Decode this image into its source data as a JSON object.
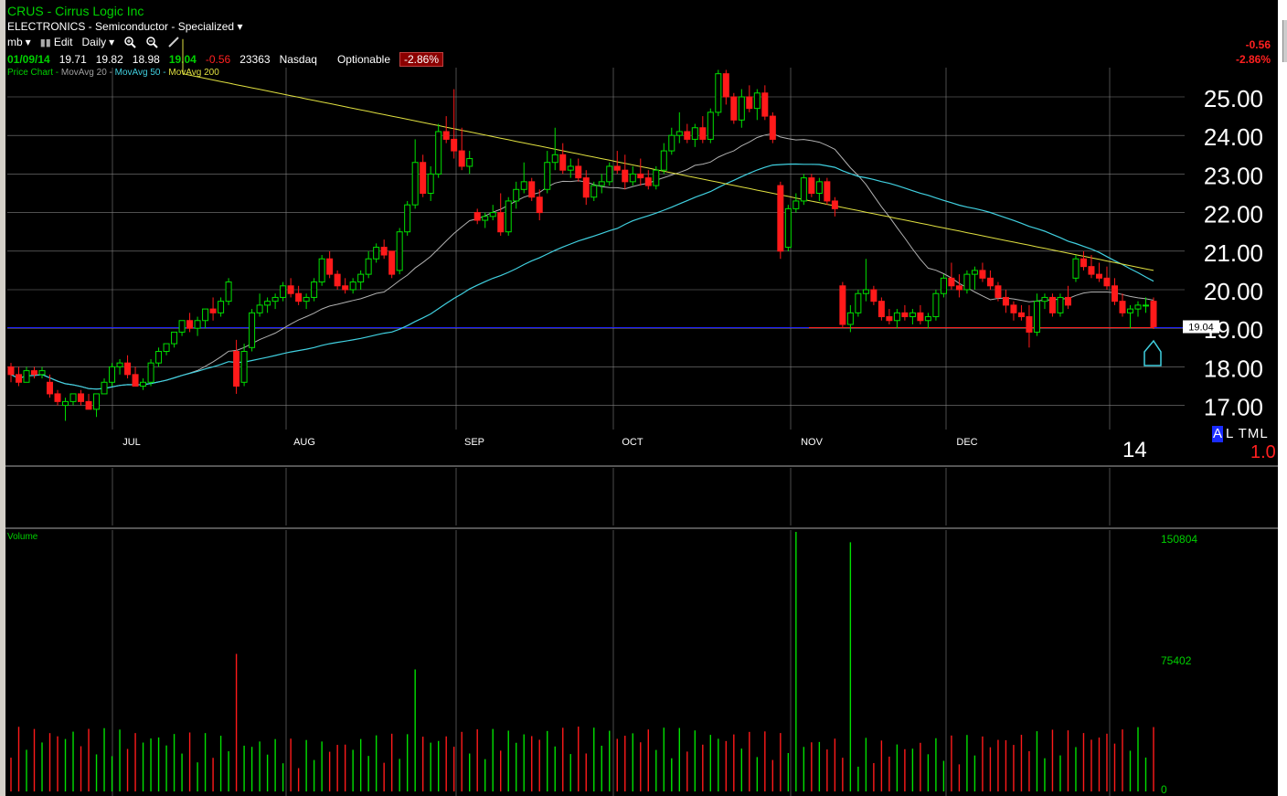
{
  "header": {
    "symbol": "CRUS",
    "company": "Cirrus Logic Inc",
    "sector": "ELECTRONICS - Semiconductor - Specialized",
    "toolbar": {
      "list": "mb",
      "edit": "Edit",
      "period": "Daily"
    },
    "quote": {
      "date": "01/09/14",
      "open": "19.71",
      "high": "19.82",
      "low": "18.98",
      "close": "19.04",
      "change": "-0.56",
      "volume": "23363",
      "exchange": "Nasdaq",
      "optionable": "Optionable",
      "pct": "-2.86%"
    },
    "legend": {
      "price": "Price Chart -",
      "ma20": "MovAvg 20 -",
      "ma50": "MovAvg 50 -",
      "ma200": "MovAvg 200"
    }
  },
  "topright": {
    "change": "-0.56",
    "pct": "-2.86%"
  },
  "badges": {
    "al": "A",
    "tml": "L TML",
    "version": "1.0",
    "year": "14"
  },
  "price_axis": {
    "current_label": "19.04"
  },
  "volume_axis": {
    "label": "Volume",
    "max": "150804",
    "mid": "75402",
    "min": "0"
  },
  "colors": {
    "up": "#00e000",
    "down": "#ff1a1a",
    "ma20": "#b0b0b0",
    "ma50": "#40d0e0",
    "ma200": "#e0e040",
    "grid": "#808080",
    "hline": "#2020ff"
  },
  "chart_data": {
    "type": "candlestick",
    "months": [
      "JUL",
      "AUG",
      "SEP",
      "OCT",
      "NOV",
      "DEC"
    ],
    "yticks": [
      "25.00",
      "24.00",
      "23.00",
      "22.00",
      "21.00",
      "20.00",
      "19.00",
      "18.00",
      "17.00"
    ],
    "ylim": [
      16.5,
      25.8
    ],
    "candles": [
      [
        18.0,
        18.1,
        17.6,
        17.8
      ],
      [
        17.8,
        18.0,
        17.5,
        17.6
      ],
      [
        17.6,
        18.0,
        17.6,
        17.9
      ],
      [
        17.9,
        18.0,
        17.7,
        17.8
      ],
      [
        17.8,
        18.0,
        17.7,
        17.9
      ],
      [
        17.6,
        17.8,
        17.2,
        17.3
      ],
      [
        17.3,
        17.4,
        17.0,
        17.1
      ],
      [
        17.0,
        17.2,
        16.6,
        17.1
      ],
      [
        17.1,
        17.3,
        17.0,
        17.3
      ],
      [
        17.3,
        17.4,
        17.0,
        17.1
      ],
      [
        17.1,
        17.3,
        16.9,
        16.9
      ],
      [
        16.9,
        17.3,
        16.7,
        17.3
      ],
      [
        17.3,
        17.7,
        17.3,
        17.6
      ],
      [
        17.6,
        18.1,
        17.5,
        18.0
      ],
      [
        18.0,
        18.2,
        17.8,
        18.1
      ],
      [
        18.1,
        18.3,
        17.7,
        17.8
      ],
      [
        17.8,
        18.0,
        17.5,
        17.5
      ],
      [
        17.5,
        17.7,
        17.4,
        17.6
      ],
      [
        17.6,
        18.2,
        17.5,
        18.1
      ],
      [
        18.1,
        18.5,
        18.0,
        18.4
      ],
      [
        18.4,
        18.6,
        18.3,
        18.6
      ],
      [
        18.6,
        18.9,
        18.5,
        18.9
      ],
      [
        18.9,
        19.2,
        18.8,
        19.2
      ],
      [
        19.2,
        19.4,
        18.9,
        19.0
      ],
      [
        19.0,
        19.3,
        18.8,
        19.2
      ],
      [
        19.2,
        19.5,
        19.0,
        19.5
      ],
      [
        19.5,
        19.8,
        19.2,
        19.4
      ],
      [
        19.4,
        19.8,
        19.3,
        19.7
      ],
      [
        19.7,
        20.3,
        19.6,
        20.2
      ],
      [
        18.4,
        18.7,
        17.3,
        17.5
      ],
      [
        17.6,
        18.6,
        17.5,
        18.4
      ],
      [
        18.5,
        19.5,
        18.4,
        19.4
      ],
      [
        19.4,
        19.9,
        19.3,
        19.6
      ],
      [
        19.6,
        19.8,
        19.4,
        19.7
      ],
      [
        19.7,
        19.9,
        19.5,
        19.8
      ],
      [
        19.8,
        20.2,
        19.7,
        20.1
      ],
      [
        20.1,
        20.3,
        19.8,
        19.9
      ],
      [
        19.9,
        20.1,
        19.6,
        19.7
      ],
      [
        19.7,
        19.9,
        19.5,
        19.8
      ],
      [
        19.8,
        20.3,
        19.7,
        20.2
      ],
      [
        20.2,
        20.9,
        20.1,
        20.8
      ],
      [
        20.8,
        21.0,
        20.3,
        20.4
      ],
      [
        20.4,
        20.5,
        20.0,
        20.1
      ],
      [
        20.1,
        20.3,
        19.9,
        20.0
      ],
      [
        20.0,
        20.3,
        19.9,
        20.2
      ],
      [
        20.2,
        20.5,
        20.0,
        20.4
      ],
      [
        20.4,
        21.0,
        20.3,
        20.8
      ],
      [
        20.8,
        21.2,
        20.7,
        21.1
      ],
      [
        21.1,
        21.3,
        20.8,
        20.9
      ],
      [
        21.0,
        21.0,
        20.3,
        20.4
      ],
      [
        20.5,
        21.6,
        20.4,
        21.5
      ],
      [
        21.5,
        22.3,
        21.4,
        22.2
      ],
      [
        22.2,
        23.9,
        22.1,
        23.3
      ],
      [
        23.3,
        23.5,
        22.4,
        22.5
      ],
      [
        22.5,
        23.2,
        22.3,
        23.0
      ],
      [
        23.0,
        24.3,
        22.9,
        24.1
      ],
      [
        24.1,
        24.5,
        23.8,
        23.9
      ],
      [
        23.9,
        25.2,
        23.4,
        23.6
      ],
      [
        23.6,
        24.2,
        23.1,
        23.2
      ],
      [
        23.2,
        23.6,
        23.0,
        23.4
      ],
      [
        22.0,
        22.1,
        21.7,
        21.8
      ],
      [
        21.8,
        22.0,
        21.6,
        21.9
      ],
      [
        21.9,
        22.2,
        21.8,
        22.0
      ],
      [
        22.0,
        22.5,
        21.4,
        21.5
      ],
      [
        21.5,
        22.4,
        21.4,
        22.3
      ],
      [
        22.3,
        22.8,
        22.1,
        22.6
      ],
      [
        22.6,
        23.3,
        22.5,
        22.8
      ],
      [
        22.8,
        22.9,
        22.3,
        22.4
      ],
      [
        22.4,
        22.6,
        21.8,
        22.0
      ],
      [
        22.6,
        23.6,
        22.5,
        23.3
      ],
      [
        23.3,
        24.2,
        23.1,
        23.5
      ],
      [
        23.5,
        23.8,
        23.0,
        23.1
      ],
      [
        23.1,
        23.4,
        22.9,
        23.2
      ],
      [
        23.2,
        23.4,
        22.8,
        22.9
      ],
      [
        22.9,
        23.1,
        22.2,
        22.4
      ],
      [
        22.4,
        22.8,
        22.3,
        22.7
      ],
      [
        22.7,
        23.0,
        22.5,
        22.8
      ],
      [
        22.8,
        23.3,
        22.7,
        23.2
      ],
      [
        23.2,
        23.6,
        23.0,
        23.1
      ],
      [
        23.1,
        23.5,
        22.6,
        22.8
      ],
      [
        22.8,
        23.2,
        22.7,
        23.0
      ],
      [
        23.0,
        23.4,
        22.7,
        22.9
      ],
      [
        22.9,
        23.1,
        22.6,
        22.7
      ],
      [
        22.7,
        23.2,
        22.6,
        23.1
      ],
      [
        23.1,
        23.8,
        23.0,
        23.6
      ],
      [
        23.6,
        24.2,
        23.5,
        24.0
      ],
      [
        24.0,
        24.6,
        23.8,
        24.1
      ],
      [
        24.1,
        24.3,
        23.8,
        23.9
      ],
      [
        23.9,
        24.3,
        23.7,
        24.2
      ],
      [
        24.2,
        24.5,
        23.8,
        23.9
      ],
      [
        23.9,
        24.7,
        23.8,
        24.6
      ],
      [
        24.6,
        25.7,
        24.5,
        25.6
      ],
      [
        25.6,
        25.7,
        24.8,
        25.0
      ],
      [
        25.0,
        25.1,
        24.3,
        24.4
      ],
      [
        24.4,
        25.2,
        24.2,
        25.0
      ],
      [
        25.0,
        25.3,
        24.6,
        24.7
      ],
      [
        24.7,
        25.2,
        24.4,
        25.1
      ],
      [
        25.1,
        25.3,
        24.4,
        24.5
      ],
      [
        24.5,
        24.6,
        23.8,
        23.9
      ],
      [
        22.7,
        22.8,
        20.8,
        21.0
      ],
      [
        21.1,
        22.2,
        21.0,
        22.1
      ],
      [
        22.1,
        22.5,
        22.0,
        22.3
      ],
      [
        22.3,
        23.0,
        22.2,
        22.9
      ],
      [
        22.9,
        23.0,
        22.4,
        22.5
      ],
      [
        22.5,
        22.9,
        22.3,
        22.8
      ],
      [
        22.8,
        22.9,
        22.2,
        22.3
      ],
      [
        22.3,
        22.4,
        21.9,
        22.1
      ],
      [
        20.1,
        20.2,
        19.0,
        19.1
      ],
      [
        19.1,
        19.6,
        18.9,
        19.4
      ],
      [
        19.4,
        20.0,
        19.3,
        19.9
      ],
      [
        19.9,
        20.8,
        19.7,
        20.0
      ],
      [
        20.0,
        20.1,
        19.6,
        19.7
      ],
      [
        19.7,
        19.8,
        19.2,
        19.3
      ],
      [
        19.3,
        19.5,
        19.1,
        19.2
      ],
      [
        19.2,
        19.5,
        19.0,
        19.4
      ],
      [
        19.4,
        19.6,
        19.2,
        19.3
      ],
      [
        19.3,
        19.5,
        19.1,
        19.4
      ],
      [
        19.4,
        19.6,
        19.1,
        19.2
      ],
      [
        19.2,
        19.4,
        19.0,
        19.3
      ],
      [
        19.3,
        20.0,
        19.2,
        19.9
      ],
      [
        19.9,
        20.4,
        19.8,
        20.3
      ],
      [
        20.3,
        20.7,
        20.0,
        20.1
      ],
      [
        20.1,
        20.4,
        19.8,
        20.0
      ],
      [
        20.0,
        20.5,
        19.9,
        20.4
      ],
      [
        20.4,
        20.6,
        20.0,
        20.5
      ],
      [
        20.5,
        20.7,
        20.2,
        20.3
      ],
      [
        20.3,
        20.5,
        20.0,
        20.1
      ],
      [
        20.1,
        20.2,
        19.7,
        19.8
      ],
      [
        19.8,
        20.0,
        19.4,
        19.6
      ],
      [
        19.6,
        19.7,
        19.2,
        19.4
      ],
      [
        19.4,
        19.6,
        19.2,
        19.3
      ],
      [
        19.3,
        19.6,
        18.5,
        18.9
      ],
      [
        18.9,
        19.9,
        18.8,
        19.7
      ],
      [
        19.7,
        19.9,
        19.5,
        19.8
      ],
      [
        19.8,
        19.9,
        19.3,
        19.4
      ],
      [
        19.4,
        19.9,
        19.3,
        19.8
      ],
      [
        19.8,
        20.1,
        19.5,
        19.6
      ],
      [
        20.3,
        20.9,
        20.2,
        20.8
      ],
      [
        20.8,
        21.0,
        20.5,
        20.6
      ],
      [
        20.6,
        20.9,
        20.3,
        20.4
      ],
      [
        20.4,
        20.7,
        20.2,
        20.3
      ],
      [
        20.3,
        20.6,
        20.0,
        20.1
      ],
      [
        20.1,
        20.3,
        19.6,
        19.7
      ],
      [
        19.7,
        19.9,
        19.3,
        19.4
      ],
      [
        19.4,
        19.6,
        19.0,
        19.5
      ],
      [
        19.5,
        19.7,
        19.3,
        19.6
      ],
      [
        19.6,
        19.8,
        19.4,
        19.6
      ],
      [
        19.7,
        19.8,
        18.98,
        19.04
      ]
    ],
    "volume_max": 150804
  }
}
